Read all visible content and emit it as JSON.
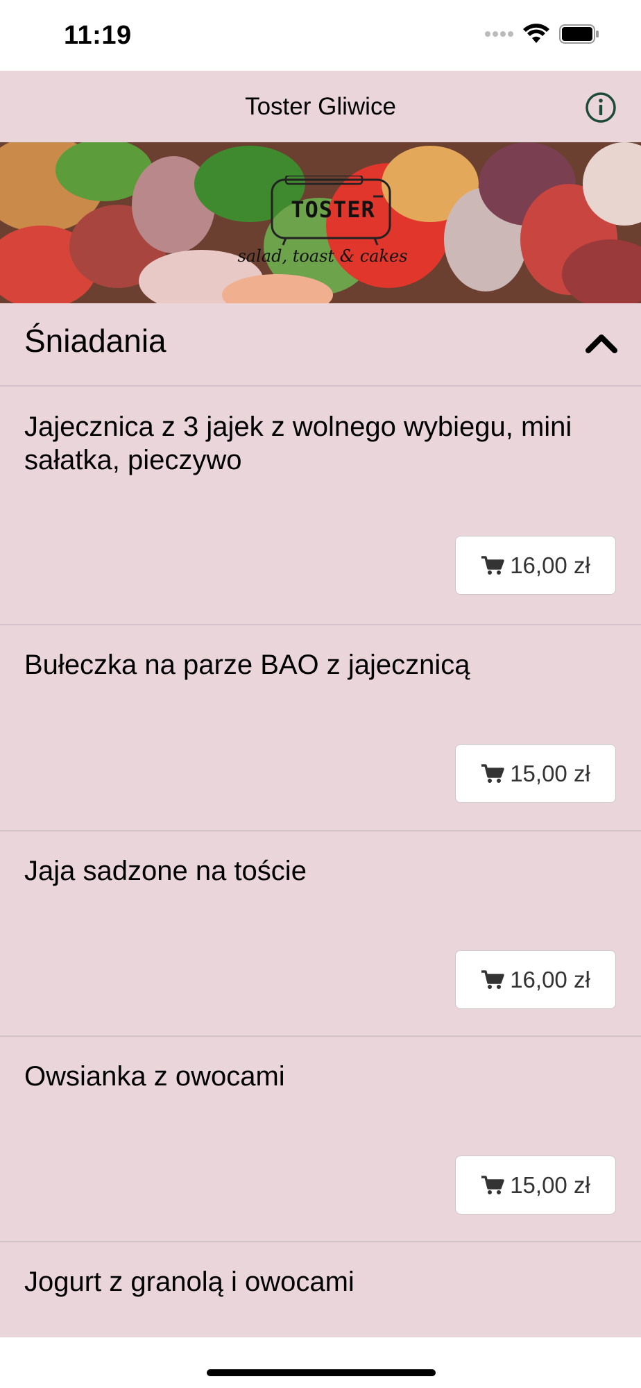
{
  "status": {
    "time": "11:19",
    "icons": [
      "signal-dots-icon",
      "wifi-icon",
      "battery-icon"
    ]
  },
  "nav": {
    "title": "Toster Gliwice",
    "info_icon": "info-icon"
  },
  "hero": {
    "logo_word": "TOSTER",
    "logo_tagline": "salad, toast & cakes"
  },
  "section": {
    "title": "Śniadania",
    "expanded": true,
    "toggle_icon": "chevron-up-icon"
  },
  "items": [
    {
      "name": "Jajecznica z 3 jajek z wolnego wybiegu, mini sałatka, pieczywo",
      "price": "16,00 zł"
    },
    {
      "name": "Bułeczka na parze BAO z jajecznicą",
      "price": "15,00 zł"
    },
    {
      "name": "Jaja sadzone na toście",
      "price": "16,00 zł"
    },
    {
      "name": "Owsianka z owocami",
      "price": "15,00 zł"
    },
    {
      "name": "Jogurt z granolą i owocami",
      "price": ""
    }
  ],
  "colors": {
    "background": "#ead5db",
    "divider": "#d3c2c7",
    "info_icon": "#1e4a3a"
  }
}
